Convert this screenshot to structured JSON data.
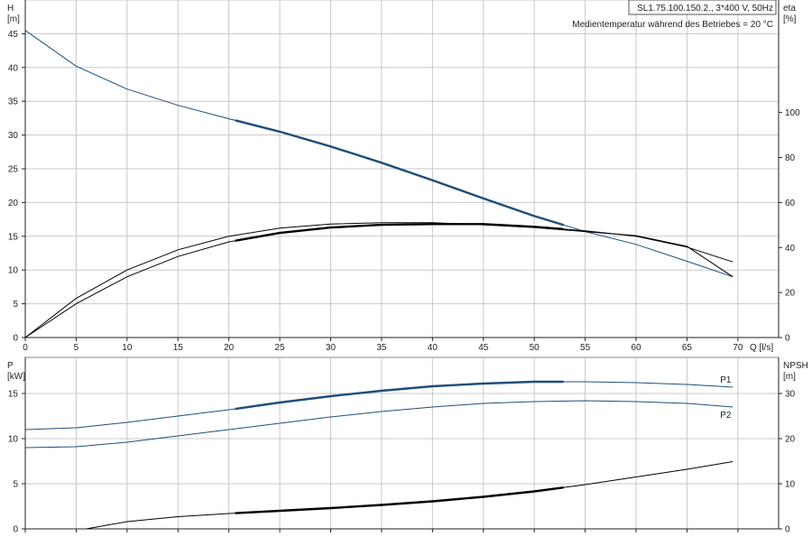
{
  "chart_data": [
    {
      "type": "line",
      "title": "SL1.75.100.150.2., 3*400 V, 50Hz",
      "subtitle": "Medientemperatur während des Betriebes = 20 °C",
      "xlabel": "Q [l/s]",
      "ylabel": "H",
      "ylabel_unit": "[m]",
      "y2label": "eta",
      "y2label_unit": "[%]",
      "xlim": [
        0,
        74
      ],
      "ylim": [
        0,
        50
      ],
      "y2lim": [
        0,
        150
      ],
      "x_ticks": [
        0,
        5,
        10,
        15,
        20,
        25,
        30,
        35,
        40,
        45,
        50,
        55,
        60,
        65,
        70
      ],
      "y_ticks": [
        0,
        5,
        10,
        15,
        20,
        25,
        30,
        35,
        40,
        45
      ],
      "y2_ticks": [
        0,
        20,
        40,
        60,
        80,
        100
      ],
      "grid": true,
      "series": [
        {
          "axis": "left",
          "color": "#1f4e79",
          "x": [
            0,
            5,
            10,
            15,
            20,
            25,
            30,
            35,
            40,
            45,
            50,
            55,
            60,
            65,
            69.5
          ],
          "values": [
            45.5,
            40.2,
            36.8,
            34.4,
            32.4,
            30.5,
            28.3,
            25.9,
            23.3,
            20.6,
            18.0,
            15.7,
            13.8,
            11.3,
            9.0
          ],
          "bold_range": [
            20.7,
            52.8
          ]
        },
        {
          "axis": "right",
          "color": "#000000",
          "x": [
            0,
            5,
            10,
            15,
            20,
            25,
            30,
            35,
            40,
            45,
            50,
            55,
            60,
            65,
            69.5
          ],
          "values": [
            0,
            15.0,
            27.0,
            36.0,
            42.5,
            46.5,
            48.9,
            50.1,
            50.4,
            50.4,
            49.2,
            47.4,
            45.0,
            40.2,
            33.6
          ],
          "bold_range": [
            20.7,
            52.8
          ]
        },
        {
          "axis": "right",
          "color": "#000000",
          "x": [
            0,
            5,
            10,
            15,
            20,
            25,
            30,
            35,
            40,
            45,
            50,
            55,
            60,
            65,
            69.5
          ],
          "values": [
            0,
            17.4,
            30.0,
            39.0,
            45.0,
            48.6,
            50.4,
            51.0,
            51.0,
            50.1,
            48.9,
            47.1,
            45.3,
            40.5,
            27.0
          ],
          "bold_range": []
        }
      ]
    },
    {
      "type": "line",
      "xlabel": "",
      "ylabel": "P",
      "ylabel_unit": "[kW]",
      "y2label": "NPSH",
      "y2label_unit": "[m]",
      "xlim": [
        0,
        74
      ],
      "ylim": [
        0,
        19
      ],
      "y2lim": [
        0,
        38
      ],
      "y_ticks": [
        0,
        5,
        10,
        15
      ],
      "y2_ticks": [
        0,
        10,
        20,
        30
      ],
      "grid": true,
      "series": [
        {
          "name": "P1",
          "axis": "left",
          "color": "#1f4e79",
          "x": [
            0,
            5,
            10,
            15,
            20,
            25,
            30,
            35,
            40,
            45,
            50,
            55,
            60,
            65,
            69.5
          ],
          "values": [
            11.0,
            11.2,
            11.8,
            12.5,
            13.2,
            14.0,
            14.7,
            15.3,
            15.8,
            16.1,
            16.3,
            16.3,
            16.2,
            16.0,
            15.7
          ],
          "bold_range": [
            20.7,
            52.8
          ]
        },
        {
          "name": "P2",
          "axis": "left",
          "color": "#1f4e79",
          "x": [
            0,
            5,
            10,
            15,
            20,
            25,
            30,
            35,
            40,
            45,
            50,
            55,
            60,
            65,
            69.5
          ],
          "values": [
            9.0,
            9.1,
            9.6,
            10.3,
            11.0,
            11.7,
            12.4,
            13.0,
            13.5,
            13.9,
            14.1,
            14.2,
            14.1,
            13.9,
            13.5
          ],
          "bold_range": []
        },
        {
          "axis": "right",
          "color": "#000000",
          "x": [
            6,
            10,
            15,
            20,
            25,
            30,
            35,
            40,
            45,
            50,
            55,
            60,
            65,
            69.5
          ],
          "values": [
            0,
            1.6,
            2.7,
            3.4,
            4.0,
            4.6,
            5.3,
            6.1,
            7.1,
            8.3,
            9.8,
            11.5,
            13.2,
            14.9
          ],
          "bold_range": [
            20.7,
            52.8
          ]
        }
      ]
    }
  ]
}
